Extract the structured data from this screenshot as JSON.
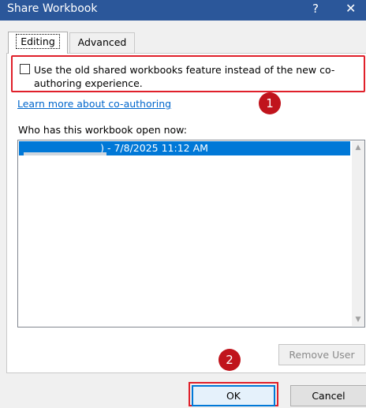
{
  "window": {
    "title": "Share Workbook",
    "help": "?",
    "close": "✕"
  },
  "tabs": [
    {
      "label": "Editing"
    },
    {
      "label": "Advanced"
    }
  ],
  "editing": {
    "option_label": "Use the old shared workbooks feature instead of the new co-authoring experience.",
    "option_checked": false,
    "learn_more": "Learn more about co-authoring",
    "who_label": "Who has this workbook open now:",
    "users": [
      {
        "name": ")",
        "detail": " - 7/8/2025 11:12 AM"
      }
    ],
    "scroll_up": "▲",
    "scroll_down": "▼"
  },
  "buttons": {
    "remove_user": "Remove User",
    "ok": "OK",
    "cancel": "Cancel"
  },
  "callouts": [
    {
      "number": "1"
    },
    {
      "number": "2"
    }
  ],
  "colors": {
    "titlebar": "#2b579a",
    "selection": "#0078d7",
    "annotation": "#e0202a",
    "link": "#0066cc"
  }
}
